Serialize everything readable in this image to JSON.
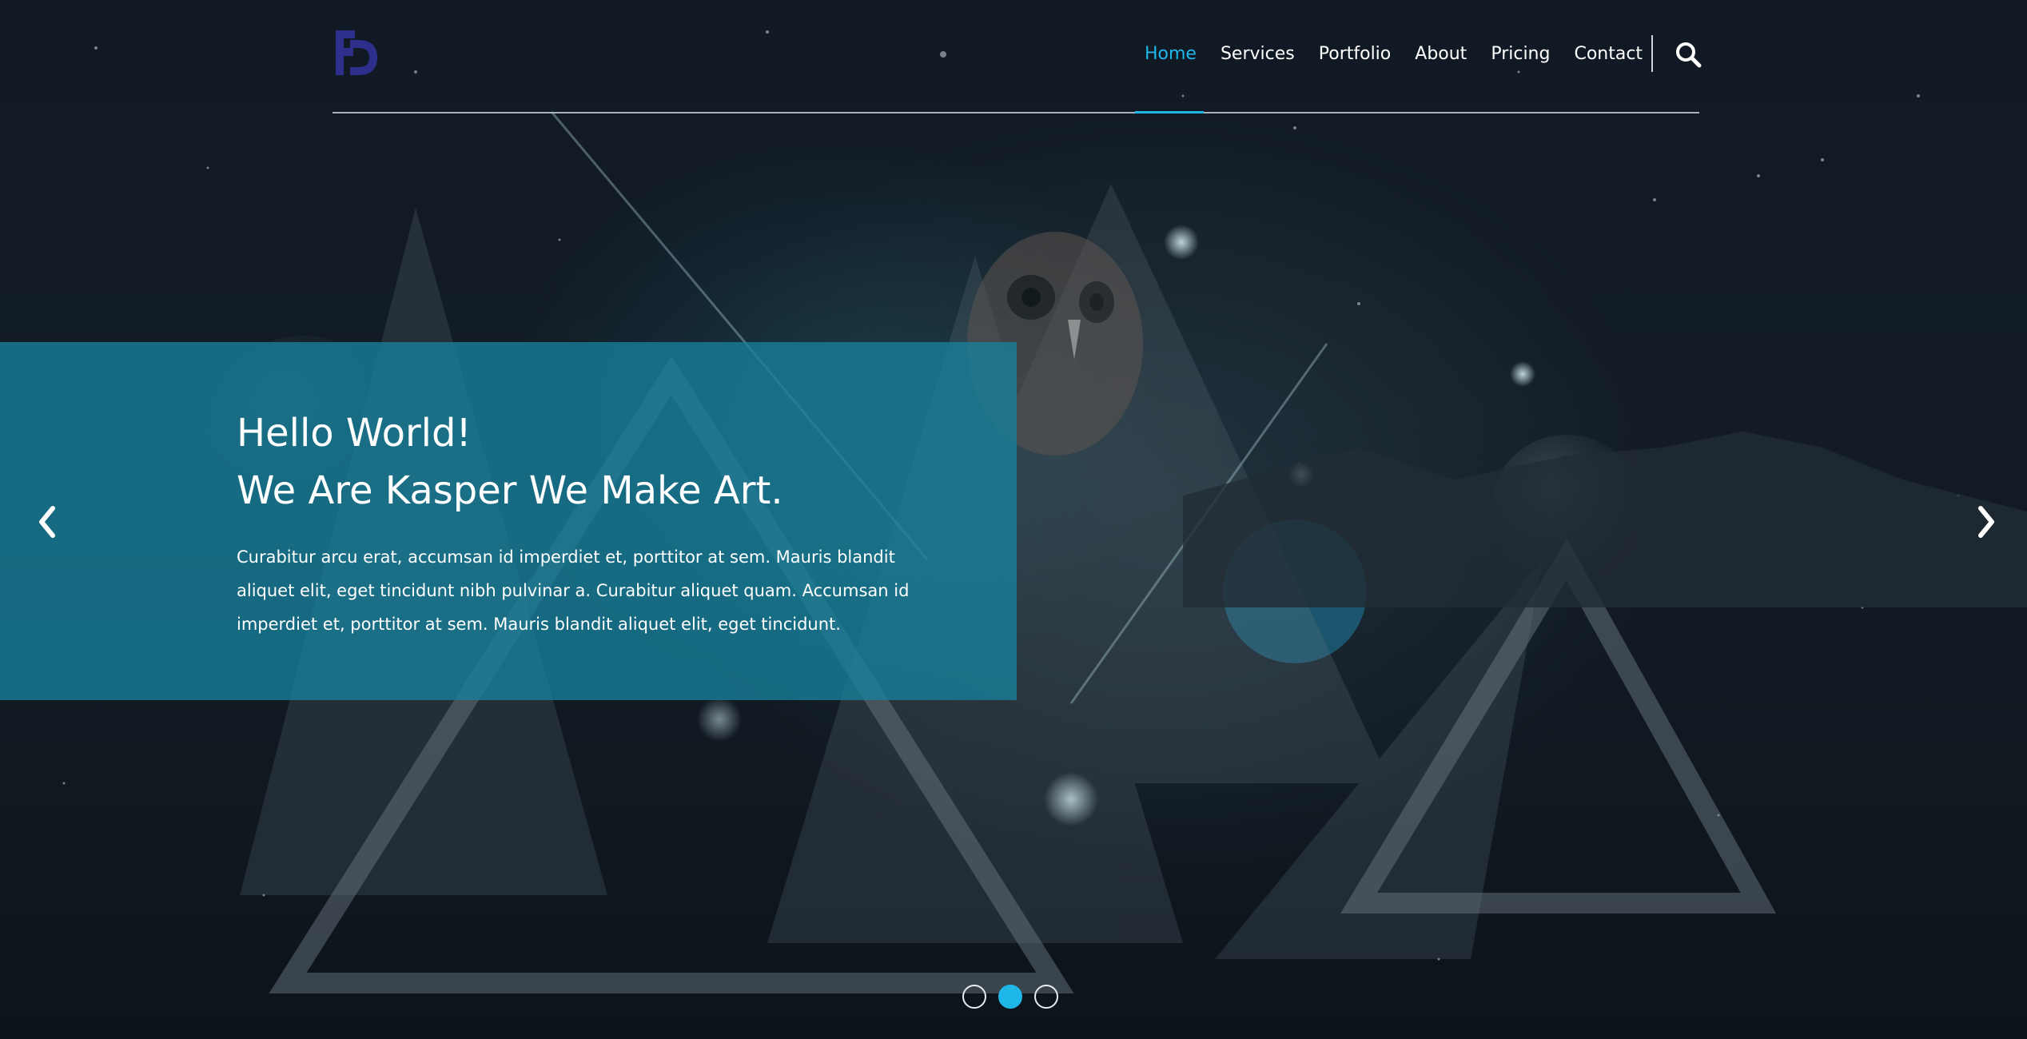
{
  "brand": {
    "logo_icon": "fd-monogram-logo",
    "logo_color": "#2e2f8c"
  },
  "nav": {
    "items": [
      {
        "label": "Home",
        "active": true
      },
      {
        "label": "Services",
        "active": false
      },
      {
        "label": "Portfolio",
        "active": false
      },
      {
        "label": "About",
        "active": false
      },
      {
        "label": "Pricing",
        "active": false
      },
      {
        "label": "Contact",
        "active": false
      }
    ],
    "search_icon": "search-icon"
  },
  "slide": {
    "title_line1": "Hello World!",
    "title_line2": "We Are Kasper We Make Art.",
    "text": "Curabitur arcu erat, accumsan id imperdiet et, porttitor at sem. Mauris blandit aliquet elit, eget tincidunt nibh pulvinar a. Curabitur aliquet quam. Accumsan id imperdiet et, porttitor at sem. Mauris blandit aliquet elit, eget tincidunt."
  },
  "controls": {
    "prev_icon": "chevron-left-icon",
    "next_icon": "chevron-right-icon",
    "bullet_count": 3,
    "active_bullet": 2
  },
  "colors": {
    "accent": "#1fb6e8",
    "panel": "#17809b",
    "background": "#111a24",
    "text": "#ffffff"
  }
}
